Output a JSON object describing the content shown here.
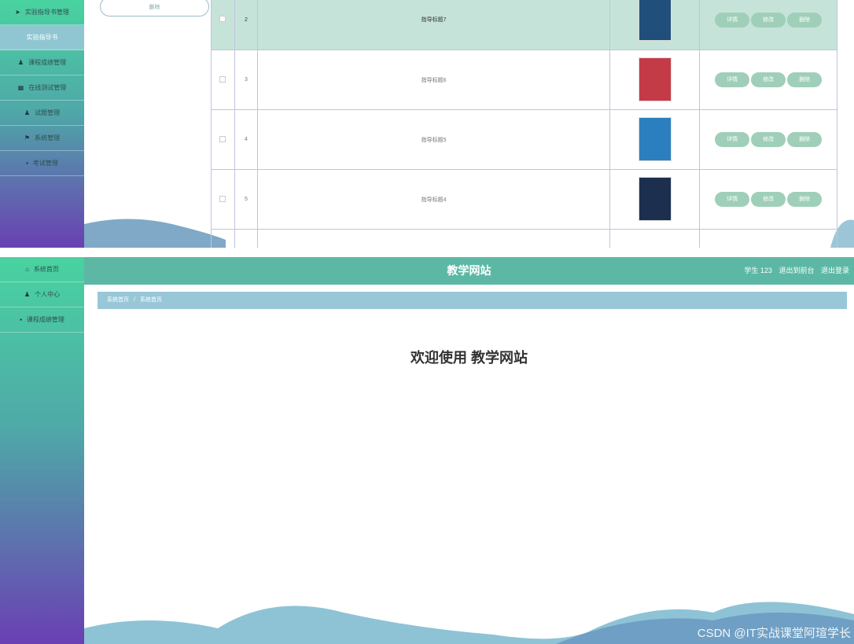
{
  "top_sidebar": {
    "items": [
      {
        "icon": "send-icon",
        "glyph": "➤",
        "label": "实验指导书管理"
      },
      {
        "label": "实验指导书",
        "sub": true
      },
      {
        "icon": "user-icon",
        "glyph": "♟",
        "label": "课程成绩管理"
      },
      {
        "icon": "grid-icon",
        "glyph": "▦",
        "label": "在线测试管理"
      },
      {
        "icon": "user-icon",
        "glyph": "♟",
        "label": "试题管理"
      },
      {
        "icon": "flag-icon",
        "glyph": "⚑",
        "label": "系统管理"
      },
      {
        "icon": "apps-icon",
        "glyph": "▪",
        "label": "考试管理"
      }
    ]
  },
  "top_panel": {
    "delete_button": "删除",
    "rows": [
      {
        "no": "2",
        "title": "指导标题7",
        "selected": true,
        "book_color": "#1f4f7a"
      },
      {
        "no": "3",
        "title": "指导标题6",
        "selected": false,
        "book_color": "#c43a46"
      },
      {
        "no": "4",
        "title": "指导标题5",
        "selected": false,
        "book_color": "#2b7fbf"
      },
      {
        "no": "5",
        "title": "指导标题4",
        "selected": false,
        "book_color": "#1c2f4f"
      }
    ],
    "ops": [
      "详情",
      "修改",
      "删除"
    ]
  },
  "bottom_sidebar": {
    "items": [
      {
        "icon": "home-icon",
        "glyph": "⌂",
        "label": "系统首页"
      },
      {
        "icon": "user-icon",
        "glyph": "♟",
        "label": "个人中心"
      },
      {
        "icon": "apps-icon",
        "glyph": "▪",
        "label": "课程成绩管理"
      }
    ]
  },
  "header": {
    "site_title": "教学网站",
    "user": "学生 123",
    "to_front": "退出到前台",
    "logout": "退出登录"
  },
  "breadcrumb": {
    "home": "系统首页",
    "sep": "/",
    "current": "系统首页"
  },
  "welcome": "欢迎使用 教学网站",
  "watermark": "CSDN @IT实战课堂阿瑄学长",
  "colors": {
    "accent": "#5cb8a4",
    "breadcrumb": "#98c8d8",
    "op_button": "#9fcfb8"
  }
}
